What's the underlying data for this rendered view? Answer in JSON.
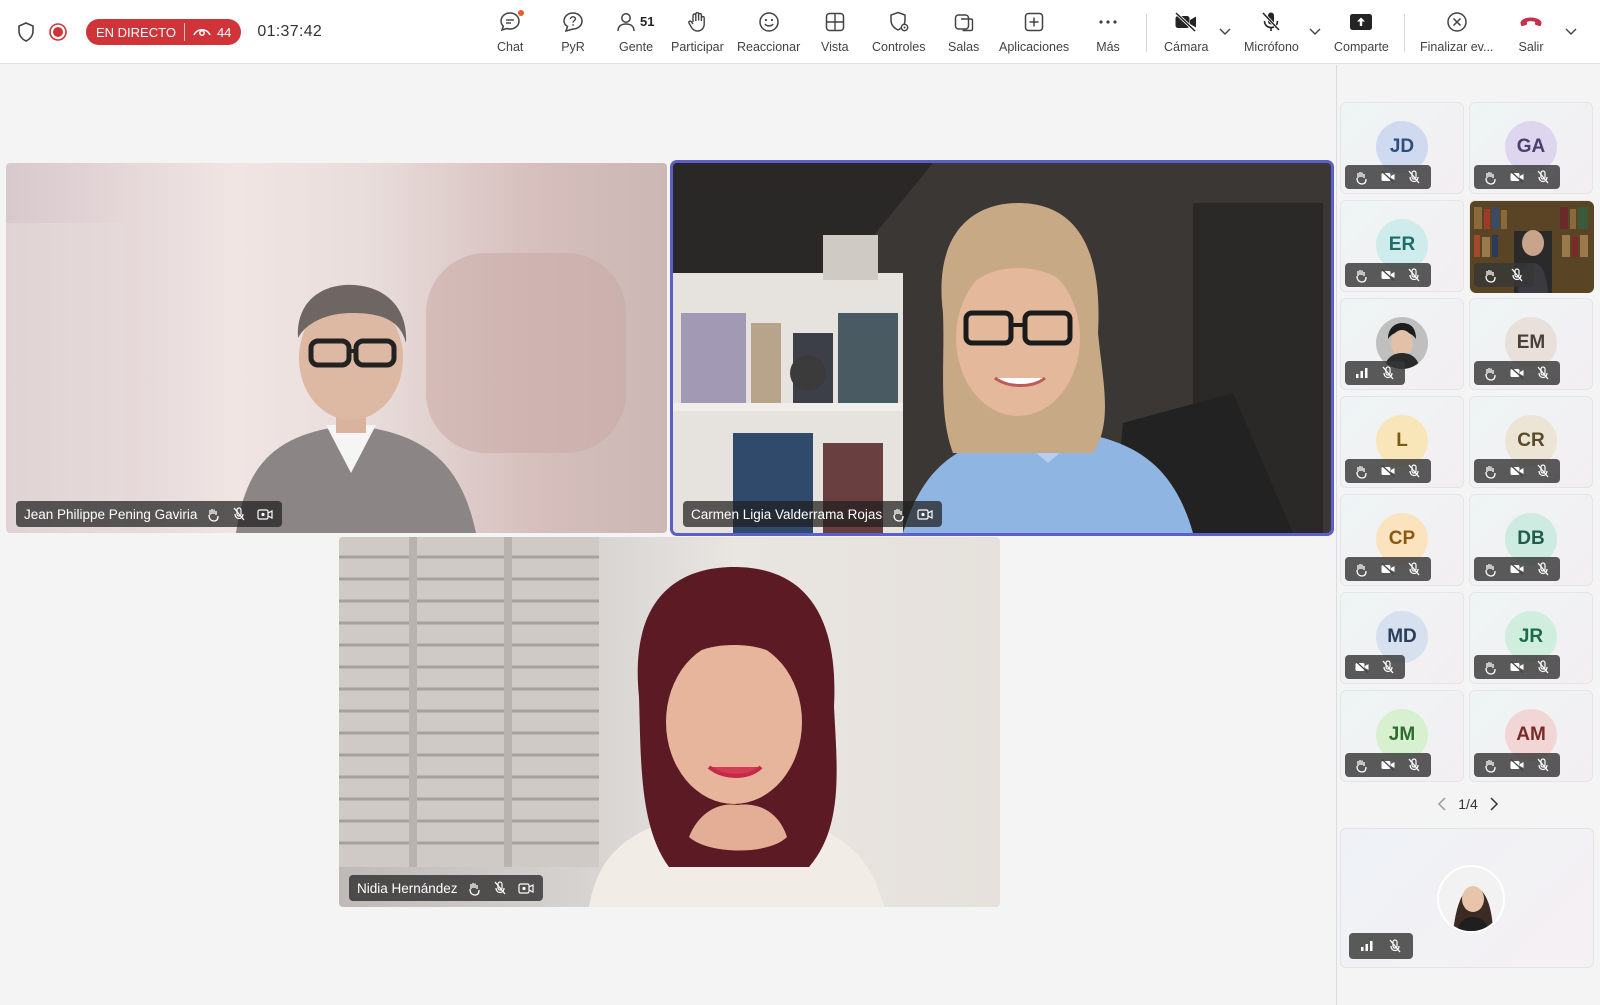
{
  "toolbar": {
    "live_label": "EN DIRECTO",
    "viewers": "44",
    "timer": "01:37:42",
    "buttons": {
      "chat": "Chat",
      "qa": "PyR",
      "people": "Gente",
      "people_count": "51",
      "raise": "Participar",
      "react": "Reaccionar",
      "view": "Vista",
      "controls": "Controles",
      "rooms": "Salas",
      "apps": "Aplicaciones",
      "more": "Más",
      "camera": "Cámara",
      "mic": "Micrófono",
      "share": "Comparte",
      "end": "Finalizar ev...",
      "leave": "Salir"
    }
  },
  "stage": {
    "tiles": [
      {
        "name": "Jean Philippe Pening Gaviria"
      },
      {
        "name": "Carmen Ligia Valderrama Rojas"
      },
      {
        "name": "Nidia Hernández"
      }
    ]
  },
  "rail": {
    "participants": [
      {
        "initials": "JD",
        "color": "#2f4d7a",
        "bg": "#cfdaf1"
      },
      {
        "initials": "GA",
        "color": "#4a3f6b",
        "bg": "#ddd6ee"
      },
      {
        "initials": "ER",
        "color": "#1f6d6b",
        "bg": "#cdeceb"
      },
      {
        "initials": "",
        "color": "#333333",
        "bg": "#6b5a3a"
      },
      {
        "initials": "",
        "color": "#333333",
        "bg": "#5a5a5a"
      },
      {
        "initials": "EM",
        "color": "#4a3f3a",
        "bg": "#eae0db"
      },
      {
        "initials": "L",
        "color": "#7a5a14",
        "bg": "#f8e6b8"
      },
      {
        "initials": "CR",
        "color": "#5a4a2a",
        "bg": "#ece4d4"
      },
      {
        "initials": "CP",
        "color": "#8a5a10",
        "bg": "#fbe3bf"
      },
      {
        "initials": "DB",
        "color": "#1f5c4e",
        "bg": "#cdebe0"
      },
      {
        "initials": "MD",
        "color": "#2a3e5a",
        "bg": "#d7e0ee"
      },
      {
        "initials": "JR",
        "color": "#1d6b4a",
        "bg": "#cfeede"
      },
      {
        "initials": "JM",
        "color": "#2f6b2f",
        "bg": "#d7f0d0"
      },
      {
        "initials": "AM",
        "color": "#7a2a2a",
        "bg": "#f2d6d6"
      }
    ],
    "page": "1/4"
  },
  "colors": {
    "accent": "#5b5fc7",
    "live": "#d13438",
    "leave": "#c4314b"
  }
}
